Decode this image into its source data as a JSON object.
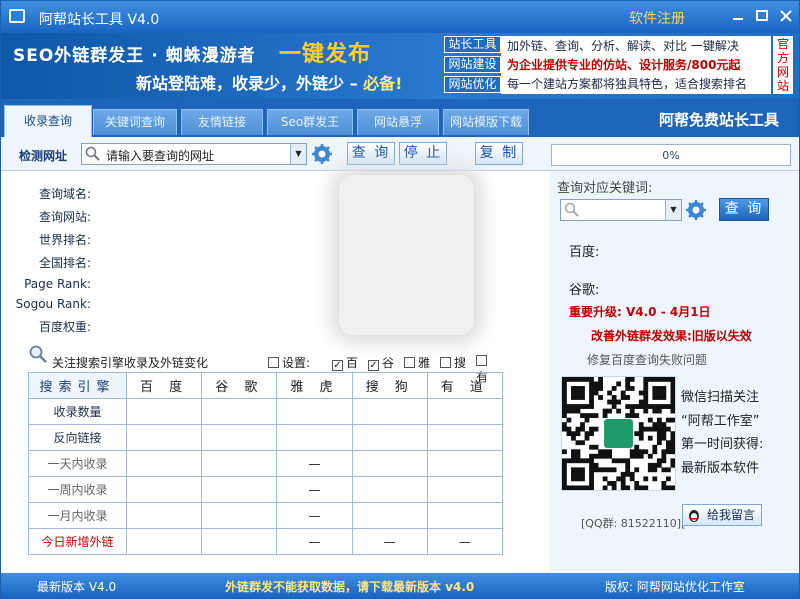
{
  "window": {
    "title": "阿帮站长工具 V4.0",
    "register_link": "软件注册"
  },
  "banner": {
    "line1": "SEO外链群发王 · 蜘蛛漫游者",
    "headline": "一键发布",
    "line2_part1": "新站登陆难，收录少，外链少 – ",
    "line2_part2": "必备!",
    "tags": [
      "站长工具",
      "网站建设",
      "网站优化"
    ],
    "lines": [
      "加外链、查询、分析、解读、对比 一键解决",
      "为企业提供专业的仿站、设计服务/800元起",
      "每一个建站方案都将独具特色，适合搜索排名"
    ],
    "official": "官方网站"
  },
  "tabs": [
    {
      "label": "收录查询",
      "active": true
    },
    {
      "label": "关键词查询",
      "active": false
    },
    {
      "label": "友情链接",
      "active": false
    },
    {
      "label": "Seo群发王",
      "active": false
    },
    {
      "label": "网站悬浮",
      "active": false
    },
    {
      "label": "网站模版下载",
      "active": false
    }
  ],
  "tabs_brand": "阿帮免费站长工具",
  "toolbar": {
    "label": "检测网址",
    "url_placeholder": "请输入要查询的网址",
    "query": "查 询",
    "stop": "停 止",
    "copy": "复 制",
    "progress": "0%",
    "progress_value": 0
  },
  "info_fields": [
    "查询域名:",
    "查询网站:",
    "世界排名:",
    "全国排名:",
    "Page Rank:",
    "Sogou Rank:",
    "百度权重:"
  ],
  "search_options": {
    "label": "关注搜索引擎收录及外链变化",
    "settings": "设置:",
    "engines": [
      {
        "name": "百",
        "checked": true
      },
      {
        "name": "谷",
        "checked": true
      },
      {
        "name": "雅",
        "checked": false
      },
      {
        "name": "搜",
        "checked": false
      },
      {
        "name": "有",
        "checked": false
      }
    ]
  },
  "table": {
    "headers": [
      "搜索引擎",
      "百 度",
      "谷 歌",
      "雅 虎",
      "搜 狗",
      "有 道"
    ],
    "rows": [
      {
        "label": "收录数量",
        "cells": [
          "",
          "",
          "",
          "",
          ""
        ]
      },
      {
        "label": "反向链接",
        "cells": [
          "",
          "",
          "",
          "",
          ""
        ]
      },
      {
        "label": "一天内收录",
        "cells": [
          "",
          "",
          "—",
          "",
          ""
        ]
      },
      {
        "label": "一周内收录",
        "cells": [
          "",
          "",
          "—",
          "",
          ""
        ]
      },
      {
        "label": "一月内收录",
        "cells": [
          "",
          "",
          "—",
          "",
          ""
        ]
      },
      {
        "label": "今日新增外链",
        "cells": [
          "",
          "",
          "—",
          "—",
          "—"
        ]
      }
    ]
  },
  "right": {
    "kw_label": "查询对应关键词:",
    "query": "查 询",
    "baidu": "百度:",
    "google": "谷歌:",
    "upgrade": "重要升级: V4.0 - 4月1日",
    "improve": "改善外链群发效果:旧版以失效",
    "fix": "修复百度查询失败问题",
    "wechat": [
      "微信扫描关注",
      "“阿帮工作室”",
      "第一时间获得:",
      "最新版本软件"
    ],
    "qq": "[QQ群: 81522110][",
    "message": "给我留言"
  },
  "statusbar": {
    "version": "最新版本 V4.0",
    "notice": "外链群发不能获取数据，请下载最新版本 v4.0",
    "copyright": "版权: 阿帮网站优化工作室"
  },
  "colors": {
    "accent": "#1a64c2",
    "warning": "#c30000",
    "highlight": "#ffce2a"
  }
}
